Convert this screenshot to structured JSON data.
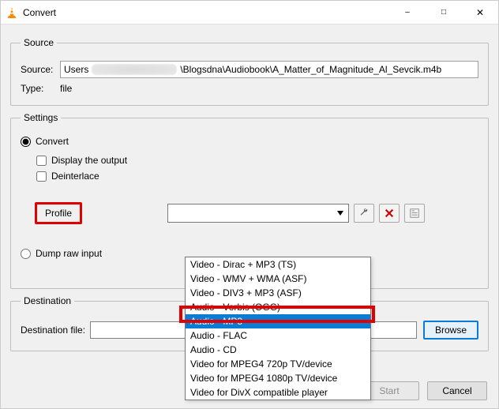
{
  "titlebar": {
    "title": "Convert"
  },
  "source": {
    "legend": "Source",
    "source_label": "Source:",
    "type_label": "Type:",
    "path_prefix": "Users",
    "path_suffix": "\\Blogsdna\\Audiobook\\A_Matter_of_Magnitude_Al_Sevcik.m4b",
    "type_value": "file"
  },
  "settings": {
    "legend": "Settings",
    "convert_label": "Convert",
    "display_output_label": "Display the output",
    "deinterlace_label": "Deinterlace",
    "profile_label": "Profile",
    "dump_label": "Dump raw input",
    "dropdown_items": [
      "Video - Dirac + MP3 (TS)",
      "Video - WMV + WMA (ASF)",
      "Video - DIV3 + MP3 (ASF)",
      "Audio - Vorbis (OGG)",
      "Audio - MP3",
      "Audio - FLAC",
      "Audio - CD",
      "Video for MPEG4 720p TV/device",
      "Video for MPEG4 1080p TV/device",
      "Video for DivX compatible player"
    ],
    "dropdown_selected_index": 4
  },
  "destination": {
    "legend": "Destination",
    "file_label": "Destination file:",
    "browse_label": "Browse"
  },
  "footer": {
    "start_label": "Start",
    "cancel_label": "Cancel"
  }
}
